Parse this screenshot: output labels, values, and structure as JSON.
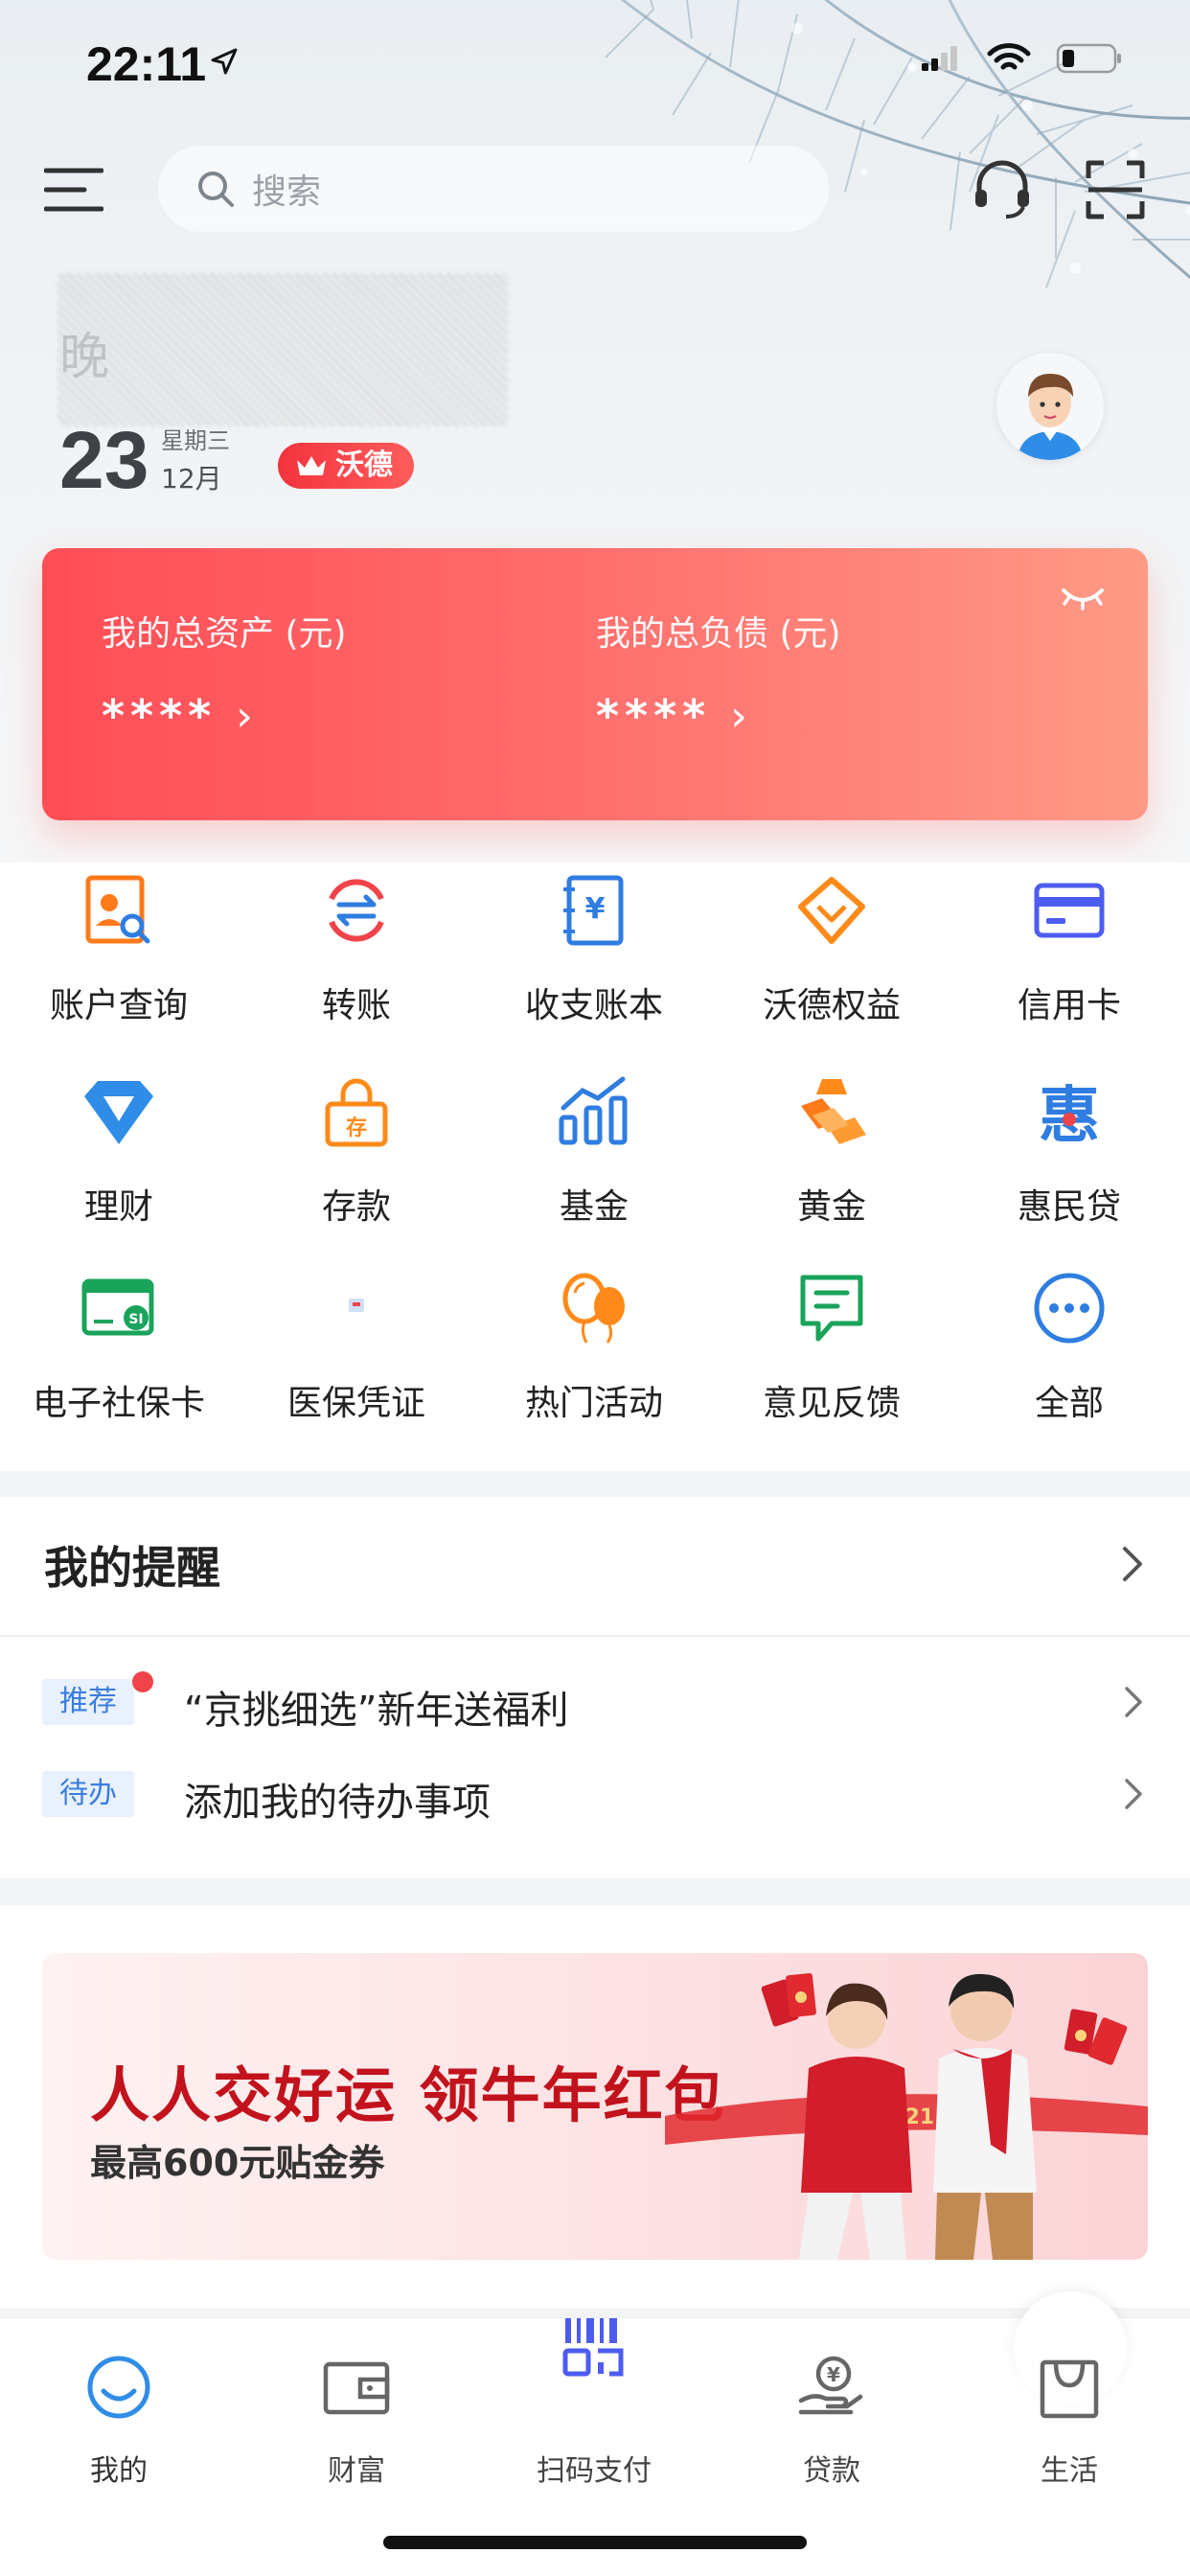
{
  "status_bar": {
    "time": "22:11"
  },
  "topbar": {
    "search_placeholder": "搜索"
  },
  "greeting": {
    "text": "晚",
    "day": "23",
    "weekday": "星期三",
    "month": "12月",
    "level_badge": "沃德"
  },
  "assets": {
    "total_assets_label": "我的总资产 (元)",
    "total_assets_value": "****",
    "total_liabilities_label": "我的总负债 (元)",
    "total_liabilities_value": "****",
    "chevron": "›"
  },
  "grid": [
    {
      "label": "账户查询",
      "icon": "account-query-icon",
      "color": "#ff7a1a"
    },
    {
      "label": "转账",
      "icon": "transfer-icon",
      "color": "#f0444a"
    },
    {
      "label": "收支账本",
      "icon": "ledger-icon",
      "color": "#2f7de1"
    },
    {
      "label": "沃德权益",
      "icon": "diamond-rights-icon",
      "color": "#ff8a1a"
    },
    {
      "label": "信用卡",
      "icon": "credit-card-icon",
      "color": "#4d5cf0"
    },
    {
      "label": "理财",
      "icon": "wealth-diamond-icon",
      "color": "#2f8de8"
    },
    {
      "label": "存款",
      "icon": "deposit-lock-icon",
      "color": "#ff8a1a"
    },
    {
      "label": "基金",
      "icon": "fund-chart-icon",
      "color": "#2f7de1"
    },
    {
      "label": "黄金",
      "icon": "gold-bars-icon",
      "color": "#ff7a1a"
    },
    {
      "label": "惠民贷",
      "icon": "huimin-loan-icon",
      "color": "#2f7de1"
    },
    {
      "label": "电子社保卡",
      "icon": "social-security-card-icon",
      "color": "#1aa35b"
    },
    {
      "label": "医保凭证",
      "icon": "medical-insurance-icon",
      "color": "#2f7de1"
    },
    {
      "label": "热门活动",
      "icon": "balloons-icon",
      "color": "#ff8a1a"
    },
    {
      "label": "意见反馈",
      "icon": "feedback-icon",
      "color": "#1aa35b"
    },
    {
      "label": "全部",
      "icon": "more-dots-icon",
      "color": "#2f7de1"
    }
  ],
  "reminders": {
    "title": "我的提醒",
    "items": [
      {
        "tag": "推荐",
        "text": "“京挑细选”新年送福利",
        "has_dot": true
      },
      {
        "tag": "待办",
        "text": "添加我的待办事项",
        "has_dot": false
      }
    ]
  },
  "banner": {
    "title": "人人交好运  领牛年红包",
    "subtitle": "最高600元贴金券",
    "year_text": "2021"
  },
  "tabbar": [
    {
      "label": "我的",
      "icon": "smile-icon"
    },
    {
      "label": "财富",
      "icon": "wallet-icon"
    },
    {
      "label": "扫码支付",
      "icon": "scan-pay-icon"
    },
    {
      "label": "贷款",
      "icon": "loan-hand-icon"
    },
    {
      "label": "生活",
      "icon": "shopping-bag-icon"
    }
  ],
  "colors": {
    "accent_red": "#ff4d56",
    "accent_blue": "#2f7de1",
    "tag_bg": "#e8f1fd"
  }
}
